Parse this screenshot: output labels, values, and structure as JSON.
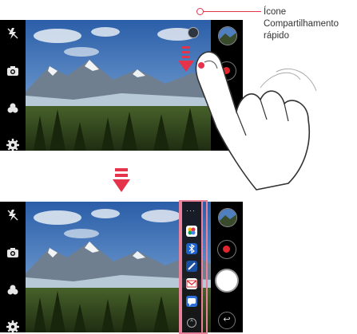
{
  "callout": {
    "line1": "Ícone",
    "line2": "Compartilhamento",
    "line3": "rápido"
  },
  "top_screen": {
    "left_controls": [
      "flash-off-icon",
      "camera-switch-icon",
      "filter-icon",
      "settings-icon"
    ],
    "right_controls": [
      "gallery-thumbnail",
      "record-button",
      "shutter-button"
    ]
  },
  "bottom_screen": {
    "share_panel_apps": [
      "gallery-app-icon",
      "bluetooth-icon",
      "edit-icon",
      "email-icon",
      "message-icon"
    ],
    "share_panel_more": "···",
    "back_label": "↩"
  },
  "colors": {
    "accent": "#e4334b",
    "highlight": "#e9829a",
    "record": "#e0262e"
  }
}
